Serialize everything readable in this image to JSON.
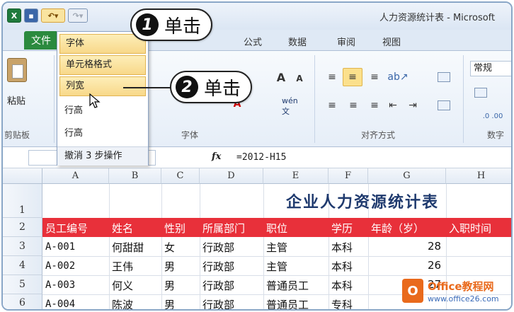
{
  "window": {
    "title": "人力资源统计表 - Microsoft"
  },
  "quick_access": {
    "undo_icon": "undo-icon",
    "redo_icon": "redo-icon",
    "save_icon": "save-icon",
    "app_icon": "excel-icon"
  },
  "ribbon": {
    "file_tab": "文件",
    "tabs": [
      "公式",
      "数据",
      "审阅",
      "视图"
    ],
    "groups": {
      "clipboard": "剪贴板",
      "font": "字体",
      "alignment": "对齐方式",
      "number": "数字"
    },
    "paste_label": "粘贴",
    "number_format": "常规",
    "grow_font": "A",
    "shrink_font": "A",
    "phonetic": "wén 文",
    "percent_labels": ".0 .00"
  },
  "undo_menu": {
    "items": [
      "字体",
      "单元格格式",
      "列宽",
      "行高",
      "行高"
    ],
    "footer": "撤消 3 步操作"
  },
  "formula_bar": {
    "fx": "fx",
    "formula": "=2012-H15"
  },
  "sheet": {
    "columns": [
      "A",
      "B",
      "C",
      "D",
      "E",
      "F",
      "G",
      "H"
    ],
    "rows": [
      "1",
      "2",
      "3",
      "4",
      "5",
      "6"
    ],
    "title": "企业人力资源统计表",
    "headers": [
      "员工编号",
      "姓名",
      "性别",
      "所属部门",
      "职位",
      "学历",
      "年龄（岁）",
      "入职时间"
    ],
    "data": [
      [
        "A-001",
        "何甜甜",
        "女",
        "行政部",
        "主管",
        "本科",
        "28"
      ],
      [
        "A-002",
        "王伟",
        "男",
        "行政部",
        "主管",
        "本科",
        "26"
      ],
      [
        "A-003",
        "何义",
        "男",
        "行政部",
        "普通员工",
        "本科",
        "27"
      ],
      [
        "A-004",
        "陈波",
        "男",
        "行政部",
        "普通员工",
        "专科",
        ""
      ]
    ]
  },
  "callouts": [
    {
      "num": "1",
      "text": "单击"
    },
    {
      "num": "2",
      "text": "单击"
    }
  ],
  "watermark": {
    "brand": "Office教程网",
    "url": "www.office26.com"
  },
  "colors": {
    "header_band": "#e8303a",
    "title": "#1f3a6e",
    "file_tab": "#2b8a3e",
    "highlight": "#fbe08c"
  }
}
